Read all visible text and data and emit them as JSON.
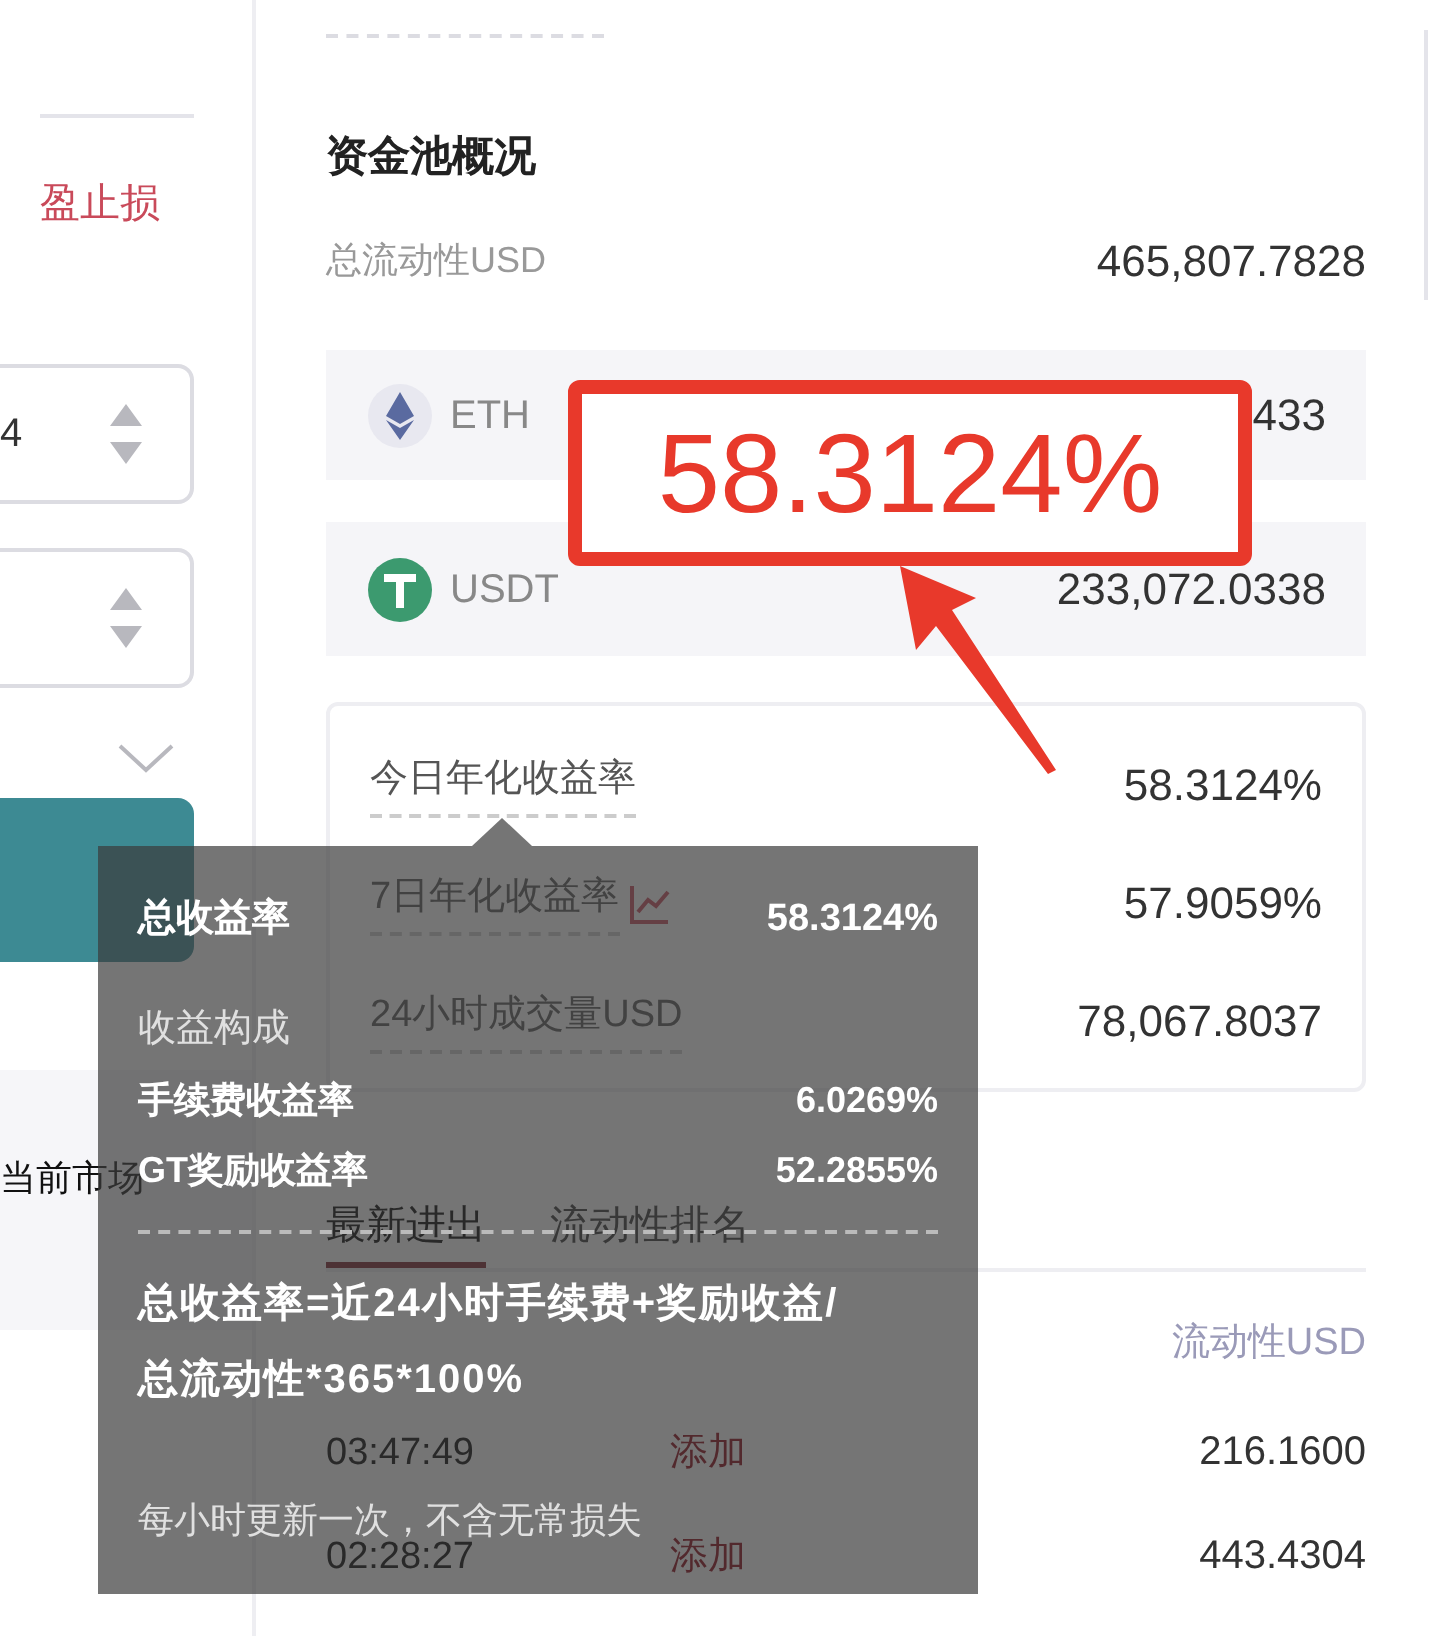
{
  "left_panel": {
    "link": "盈止损",
    "spinner_value": "4",
    "market_text": "当前市场"
  },
  "pool": {
    "title": "资金池概况",
    "total_label": "总流动性USD",
    "total_value": "465,807.7828",
    "tokens": [
      {
        "kind": "eth",
        "symbol": "ETH",
        "value": "433"
      },
      {
        "kind": "usdt",
        "symbol": "USDT",
        "value": "233,072.0338"
      }
    ],
    "stats": [
      {
        "label": "今日年化收益率",
        "value": "58.3124%",
        "chart_link": false
      },
      {
        "label": "7日年化收益率",
        "value": "57.9059%",
        "chart_link": true
      },
      {
        "label": "24小时成交量USD",
        "value": "78,067.8037",
        "chart_link": false
      }
    ]
  },
  "tabs": [
    {
      "label": "最新进出",
      "selected": true
    },
    {
      "label": "流动性排名",
      "selected": false
    }
  ],
  "table": {
    "header": "流动性USD",
    "rows": [
      {
        "time": "03:47:49",
        "action": "添加",
        "amount": "216.1600"
      },
      {
        "time": "02:28:27",
        "action": "添加",
        "amount": "443.4304"
      }
    ]
  },
  "tooltip": {
    "total_label": "总收益率",
    "total_value": "58.3124%",
    "breakdown_title": "收益构成",
    "items": [
      {
        "label": "手续费收益率",
        "value": "6.0269%"
      },
      {
        "label": "GT奖励收益率",
        "value": "52.2855%"
      }
    ],
    "formula": "总收益率=近24小时手续费+奖励收益/总流动性*365*100%",
    "note": "每小时更新一次，不含无常损失"
  },
  "callout": {
    "text": "58.3124%"
  }
}
